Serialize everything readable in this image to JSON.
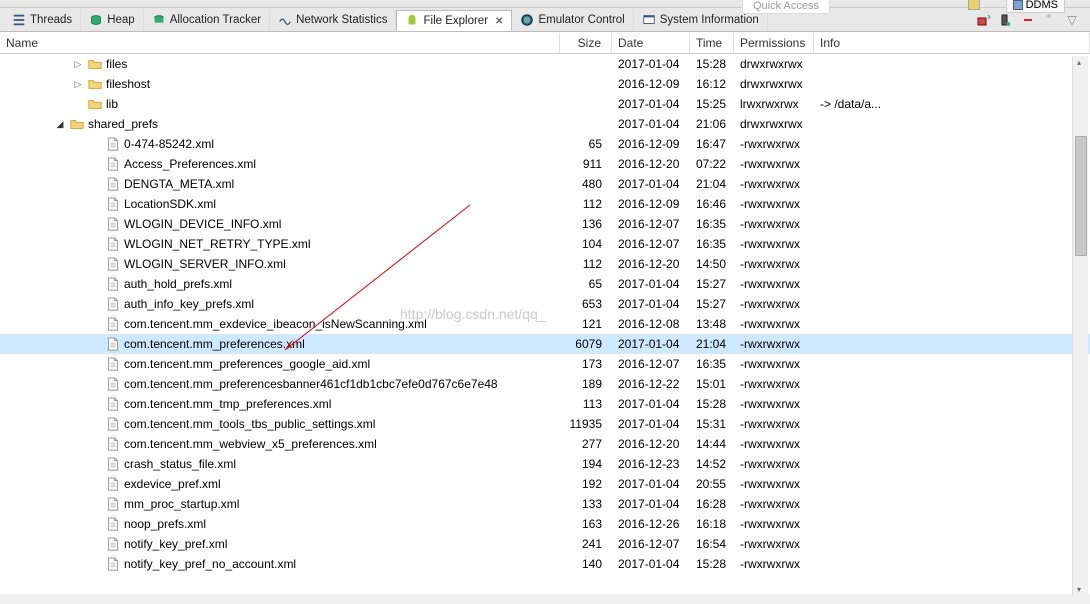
{
  "top": {
    "quick_access": "Quick Access",
    "ddms": "DDMS"
  },
  "tabs": [
    {
      "label": "Threads",
      "icon": "threads-icon"
    },
    {
      "label": "Heap",
      "icon": "heap-icon"
    },
    {
      "label": "Allocation Tracker",
      "icon": "alloc-icon"
    },
    {
      "label": "Network Statistics",
      "icon": "net-icon"
    },
    {
      "label": "File Explorer",
      "icon": "android-icon",
      "active": true,
      "closable": true
    },
    {
      "label": "Emulator Control",
      "icon": "emu-icon"
    },
    {
      "label": "System Information",
      "icon": "sys-icon"
    }
  ],
  "columns": {
    "name": "Name",
    "size": "Size",
    "date": "Date",
    "time": "Time",
    "perm": "Permissions",
    "info": "Info"
  },
  "rows": [
    {
      "indent": 4,
      "expander": "closed",
      "type": "folder",
      "name": "files",
      "size": "",
      "date": "2017-01-04",
      "time": "15:28",
      "perm": "drwxrwxrwx",
      "info": ""
    },
    {
      "indent": 4,
      "expander": "closed",
      "type": "folder",
      "name": "fileshost",
      "size": "",
      "date": "2016-12-09",
      "time": "16:12",
      "perm": "drwxrwxrwx",
      "info": ""
    },
    {
      "indent": 4,
      "expander": "none",
      "type": "folder",
      "name": "lib",
      "size": "",
      "date": "2017-01-04",
      "time": "15:25",
      "perm": "lrwxrwxrwx",
      "info": "-> /data/a..."
    },
    {
      "indent": 3,
      "expander": "open",
      "type": "folder",
      "name": "shared_prefs",
      "size": "",
      "date": "2017-01-04",
      "time": "21:06",
      "perm": "drwxrwxrwx",
      "info": ""
    },
    {
      "indent": 5,
      "expander": "none",
      "type": "file",
      "name": "0-474-85242.xml",
      "size": "65",
      "date": "2016-12-09",
      "time": "16:47",
      "perm": "-rwxrwxrwx",
      "info": ""
    },
    {
      "indent": 5,
      "expander": "none",
      "type": "file",
      "name": "Access_Preferences.xml",
      "size": "911",
      "date": "2016-12-20",
      "time": "07:22",
      "perm": "-rwxrwxrwx",
      "info": ""
    },
    {
      "indent": 5,
      "expander": "none",
      "type": "file",
      "name": "DENGTA_META.xml",
      "size": "480",
      "date": "2017-01-04",
      "time": "21:04",
      "perm": "-rwxrwxrwx",
      "info": ""
    },
    {
      "indent": 5,
      "expander": "none",
      "type": "file",
      "name": "LocationSDK.xml",
      "size": "112",
      "date": "2016-12-09",
      "time": "16:46",
      "perm": "-rwxrwxrwx",
      "info": ""
    },
    {
      "indent": 5,
      "expander": "none",
      "type": "file",
      "name": "WLOGIN_DEVICE_INFO.xml",
      "size": "136",
      "date": "2016-12-07",
      "time": "16:35",
      "perm": "-rwxrwxrwx",
      "info": ""
    },
    {
      "indent": 5,
      "expander": "none",
      "type": "file",
      "name": "WLOGIN_NET_RETRY_TYPE.xml",
      "size": "104",
      "date": "2016-12-07",
      "time": "16:35",
      "perm": "-rwxrwxrwx",
      "info": ""
    },
    {
      "indent": 5,
      "expander": "none",
      "type": "file",
      "name": "WLOGIN_SERVER_INFO.xml",
      "size": "112",
      "date": "2016-12-20",
      "time": "14:50",
      "perm": "-rwxrwxrwx",
      "info": ""
    },
    {
      "indent": 5,
      "expander": "none",
      "type": "file",
      "name": "auth_hold_prefs.xml",
      "size": "65",
      "date": "2017-01-04",
      "time": "15:27",
      "perm": "-rwxrwxrwx",
      "info": ""
    },
    {
      "indent": 5,
      "expander": "none",
      "type": "file",
      "name": "auth_info_key_prefs.xml",
      "size": "653",
      "date": "2017-01-04",
      "time": "15:27",
      "perm": "-rwxrwxrwx",
      "info": ""
    },
    {
      "indent": 5,
      "expander": "none",
      "type": "file",
      "name": "com.tencent.mm_exdevice_ibeacon_isNewScanning.xml",
      "size": "121",
      "date": "2016-12-08",
      "time": "13:48",
      "perm": "-rwxrwxrwx",
      "info": ""
    },
    {
      "indent": 5,
      "expander": "none",
      "type": "file",
      "name": "com.tencent.mm_preferences.xml",
      "size": "6079",
      "date": "2017-01-04",
      "time": "21:04",
      "perm": "-rwxrwxrwx",
      "info": "",
      "selected": true
    },
    {
      "indent": 5,
      "expander": "none",
      "type": "file",
      "name": "com.tencent.mm_preferences_google_aid.xml",
      "size": "173",
      "date": "2016-12-07",
      "time": "16:35",
      "perm": "-rwxrwxrwx",
      "info": ""
    },
    {
      "indent": 5,
      "expander": "none",
      "type": "file",
      "name": "com.tencent.mm_preferencesbanner461cf1db1cbc7efe0d767c6e7e48",
      "size": "189",
      "date": "2016-12-22",
      "time": "15:01",
      "perm": "-rwxrwxrwx",
      "info": ""
    },
    {
      "indent": 5,
      "expander": "none",
      "type": "file",
      "name": "com.tencent.mm_tmp_preferences.xml",
      "size": "113",
      "date": "2017-01-04",
      "time": "15:28",
      "perm": "-rwxrwxrwx",
      "info": ""
    },
    {
      "indent": 5,
      "expander": "none",
      "type": "file",
      "name": "com.tencent.mm_tools_tbs_public_settings.xml",
      "size": "11935",
      "date": "2017-01-04",
      "time": "15:31",
      "perm": "-rwxrwxrwx",
      "info": ""
    },
    {
      "indent": 5,
      "expander": "none",
      "type": "file",
      "name": "com.tencent.mm_webview_x5_preferences.xml",
      "size": "277",
      "date": "2016-12-20",
      "time": "14:44",
      "perm": "-rwxrwxrwx",
      "info": ""
    },
    {
      "indent": 5,
      "expander": "none",
      "type": "file",
      "name": "crash_status_file.xml",
      "size": "194",
      "date": "2016-12-23",
      "time": "14:52",
      "perm": "-rwxrwxrwx",
      "info": ""
    },
    {
      "indent": 5,
      "expander": "none",
      "type": "file",
      "name": "exdevice_pref.xml",
      "size": "192",
      "date": "2017-01-04",
      "time": "20:55",
      "perm": "-rwxrwxrwx",
      "info": ""
    },
    {
      "indent": 5,
      "expander": "none",
      "type": "file",
      "name": "mm_proc_startup.xml",
      "size": "133",
      "date": "2017-01-04",
      "time": "16:28",
      "perm": "-rwxrwxrwx",
      "info": ""
    },
    {
      "indent": 5,
      "expander": "none",
      "type": "file",
      "name": "noop_prefs.xml",
      "size": "163",
      "date": "2016-12-26",
      "time": "16:18",
      "perm": "-rwxrwxrwx",
      "info": ""
    },
    {
      "indent": 5,
      "expander": "none",
      "type": "file",
      "name": "notify_key_pref.xml",
      "size": "241",
      "date": "2016-12-07",
      "time": "16:54",
      "perm": "-rwxrwxrwx",
      "info": ""
    },
    {
      "indent": 5,
      "expander": "none",
      "type": "file",
      "name": "notify_key_pref_no_account.xml",
      "size": "140",
      "date": "2017-01-04",
      "time": "15:28",
      "perm": "-rwxrwxrwx",
      "info": ""
    }
  ],
  "watermark": "http://blog.csdn.net/qq_"
}
